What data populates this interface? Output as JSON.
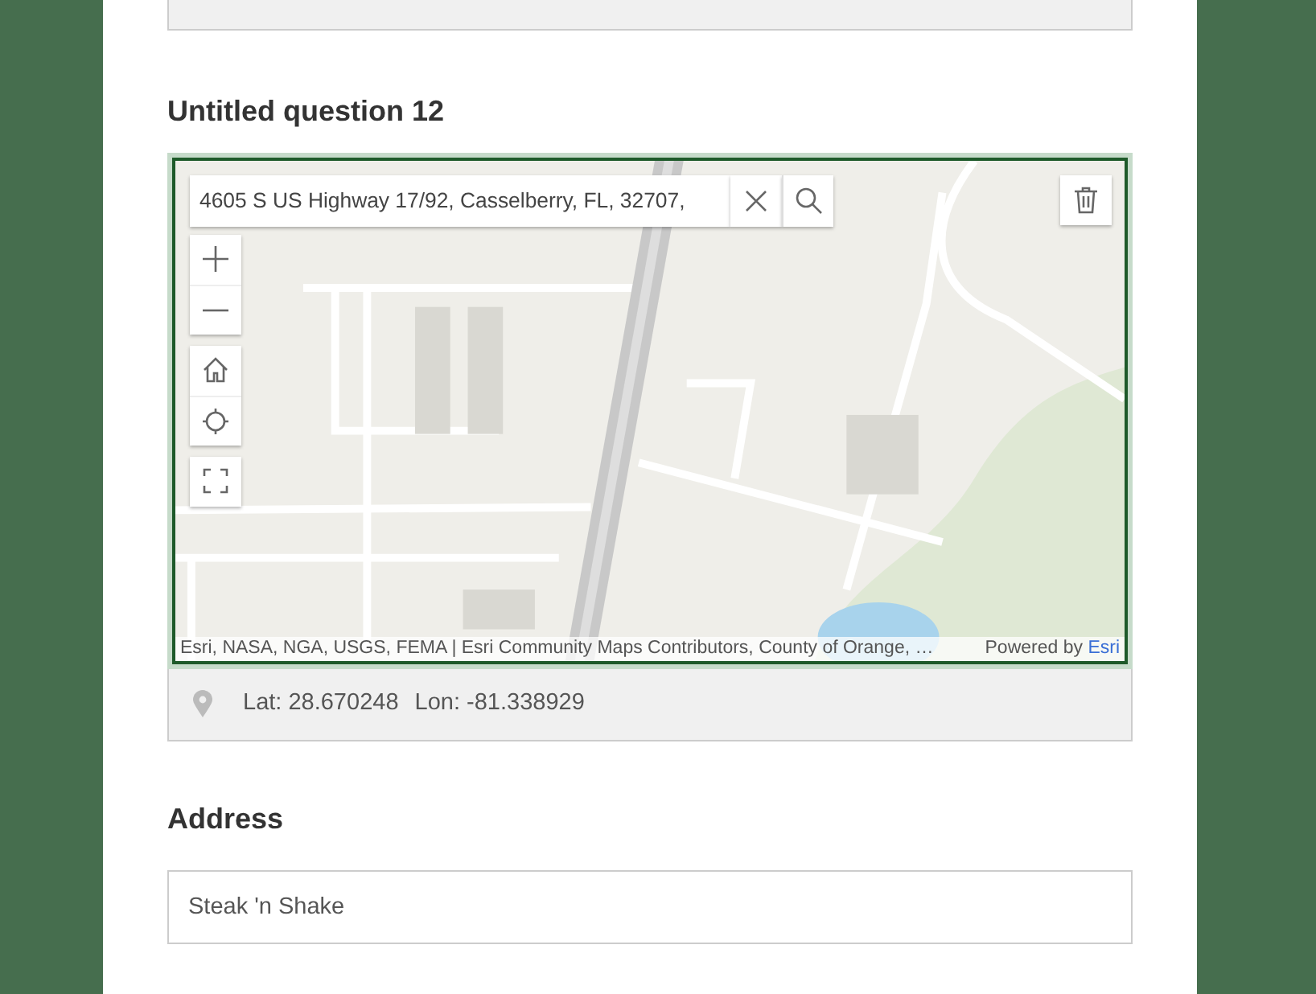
{
  "questions": [
    {
      "kind": "map",
      "label": "Untitled question 12",
      "search": {
        "value": "4605 S US Highway 17/92, Casselberry, FL, 32707,"
      },
      "attribution": {
        "text": "Esri, NASA, NGA, USGS, FEMA | Esri Community Maps Contributors, County of Orange, …",
        "powered_by": "Powered by",
        "link": "Esri"
      },
      "latitude": "Lat: 28.670248",
      "longitude": "Lon: -81.338929"
    },
    {
      "kind": "text",
      "label": "Address",
      "value": "Steak 'n Shake"
    }
  ]
}
